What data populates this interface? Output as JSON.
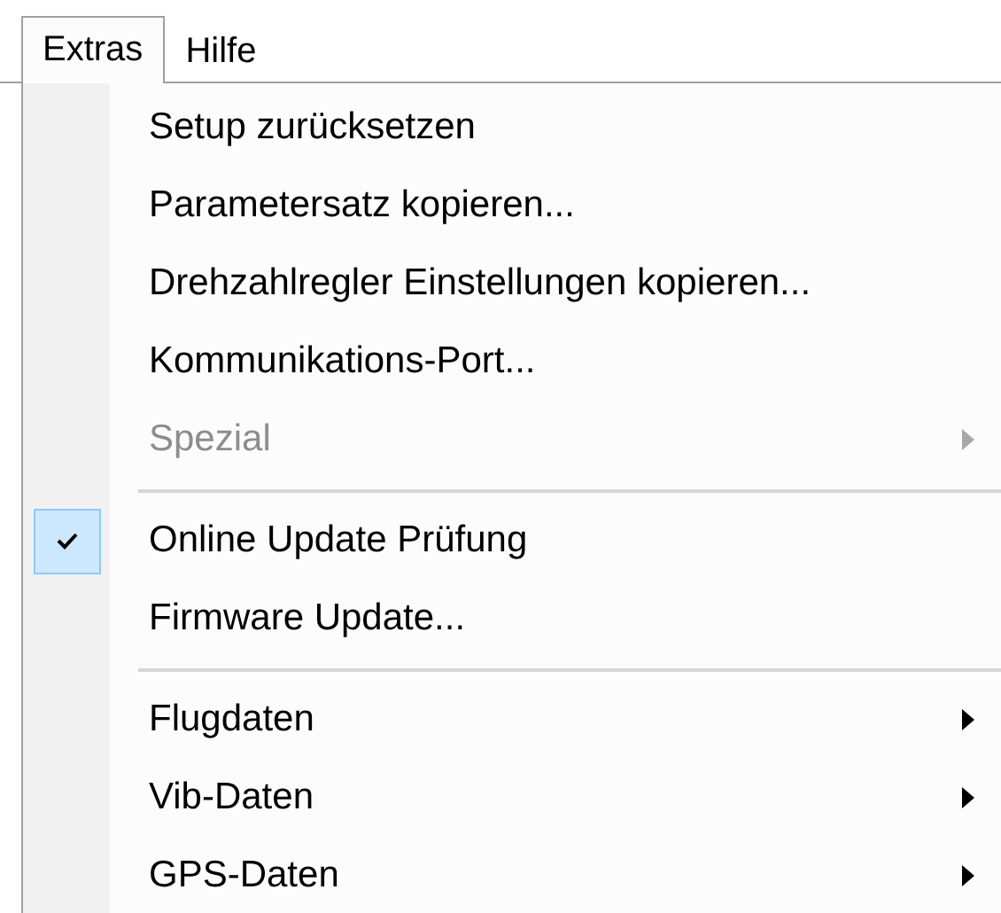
{
  "menubar": [
    {
      "label": "Extras",
      "selected": true
    },
    {
      "label": "Hilfe",
      "selected": false
    }
  ],
  "menu": [
    {
      "kind": "item",
      "label": "Setup zurücksetzen",
      "disabled": false,
      "checked": false,
      "submenu": false
    },
    {
      "kind": "item",
      "label": "Parametersatz kopieren...",
      "disabled": false,
      "checked": false,
      "submenu": false
    },
    {
      "kind": "item",
      "label": "Drehzahlregler Einstellungen kopieren...",
      "disabled": false,
      "checked": false,
      "submenu": false
    },
    {
      "kind": "item",
      "label": "Kommunikations-Port...",
      "disabled": false,
      "checked": false,
      "submenu": false
    },
    {
      "kind": "item",
      "label": "Spezial",
      "disabled": true,
      "checked": false,
      "submenu": true
    },
    {
      "kind": "separator"
    },
    {
      "kind": "item",
      "label": "Online Update Prüfung",
      "disabled": false,
      "checked": true,
      "submenu": false
    },
    {
      "kind": "item",
      "label": "Firmware Update...",
      "disabled": false,
      "checked": false,
      "submenu": false
    },
    {
      "kind": "separator"
    },
    {
      "kind": "item",
      "label": "Flugdaten",
      "disabled": false,
      "checked": false,
      "submenu": true
    },
    {
      "kind": "item",
      "label": "Vib-Daten",
      "disabled": false,
      "checked": false,
      "submenu": true
    },
    {
      "kind": "item",
      "label": "GPS-Daten",
      "disabled": false,
      "checked": false,
      "submenu": true
    }
  ]
}
